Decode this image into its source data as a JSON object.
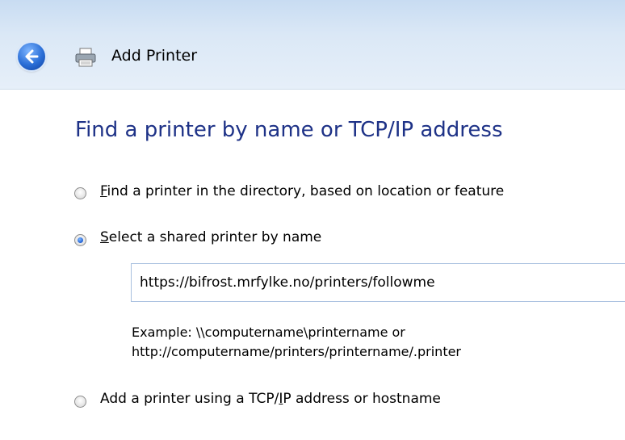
{
  "window": {
    "title": "Add Printer",
    "icons": [
      "back-arrow-icon",
      "printer-icon"
    ]
  },
  "page": {
    "heading": "Find a printer by name or TCP/IP address"
  },
  "options": [
    {
      "label_first": "F",
      "label_rest": "ind a printer in the directory, based on location or feature",
      "selected": false
    },
    {
      "label_first": "S",
      "label_rest": "elect a shared printer by name",
      "selected": true
    },
    {
      "label_prefix": "Add a printer using a TCP/",
      "label_first": "I",
      "label_rest": "P address or hostname",
      "selected": false
    }
  ],
  "shared_printer": {
    "value": "https://bifrost.mrfylke.no/printers/followme",
    "example_line1": "Example: \\\\computername\\printername or",
    "example_line2": "http://computername/printers/printername/.printer"
  },
  "colors": {
    "heading": "#1e3287",
    "titlebar": "#dbe8f6"
  }
}
